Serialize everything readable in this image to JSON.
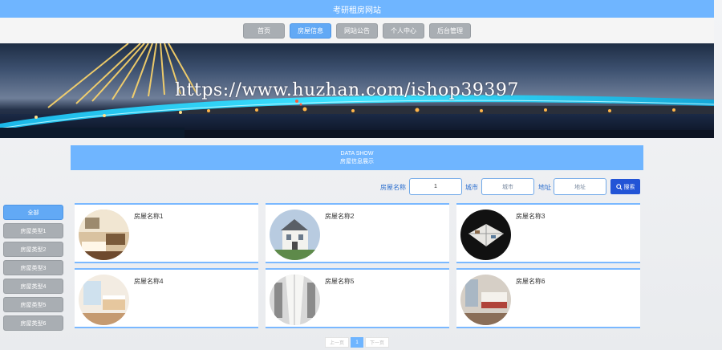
{
  "site": {
    "title": "考研租房网站"
  },
  "nav": [
    {
      "label": "首页",
      "active": false
    },
    {
      "label": "房屋信息",
      "active": true
    },
    {
      "label": "网站公告",
      "active": false
    },
    {
      "label": "个人中心",
      "active": false
    },
    {
      "label": "后台管理",
      "active": false
    }
  ],
  "banner": {
    "watermark": "https://www.huzhan.com/ishop39397"
  },
  "section": {
    "title_en": "DATA SHOW",
    "title_cn": "房屋信息展示"
  },
  "search": {
    "name_label": "房屋名称",
    "name_value": "1",
    "city_label": "城市",
    "city_placeholder": "城市",
    "address_label": "地址",
    "address_placeholder": "地址",
    "button_label": "搜索"
  },
  "sidebar": [
    {
      "label": "全部",
      "active": true
    },
    {
      "label": "房屋类型1",
      "active": false
    },
    {
      "label": "房屋类型2",
      "active": false
    },
    {
      "label": "房屋类型3",
      "active": false
    },
    {
      "label": "房屋类型4",
      "active": false
    },
    {
      "label": "房屋类型5",
      "active": false
    },
    {
      "label": "房屋类型6",
      "active": false
    }
  ],
  "houses": [
    {
      "name": "房屋名称1"
    },
    {
      "name": "房屋名称2"
    },
    {
      "name": "房屋名称3"
    },
    {
      "name": "房屋名称4"
    },
    {
      "name": "房屋名称5"
    },
    {
      "name": "房屋名称6"
    }
  ],
  "pagination": {
    "prev": "上一页",
    "current": "1",
    "next": "下一页"
  },
  "colors": {
    "accent": "#6fb5ff",
    "button_gray": "#a9aeb3",
    "search_button": "#2254d6"
  }
}
